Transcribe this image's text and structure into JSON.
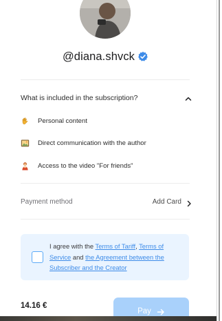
{
  "profile": {
    "username": "@diana.shvck",
    "verified_icon": "verified-badge-icon",
    "accent_color": "#3d8be8"
  },
  "subscription": {
    "title": "What is included in the subscription?",
    "toggle_icon": "chevron-up-icon",
    "features": [
      {
        "icon": "hand-wave-icon",
        "label": "Personal content"
      },
      {
        "icon": "picture-frame-icon",
        "label": "Direct communication with the author"
      },
      {
        "icon": "person-emoji-icon",
        "label": "Access to the video \"For friends\""
      }
    ]
  },
  "payment": {
    "label": "Payment method",
    "action": "Add Card"
  },
  "agreement": {
    "prefix": "I agree with the",
    "terms_of_tariff": "Terms of Tariff",
    "comma": ",",
    "terms_of_service": "Terms of Service",
    "and": "and",
    "agreement_link": "the Agreement between the Subscriber and the Creator",
    "checked": false
  },
  "checkout": {
    "price": "14.16 €",
    "pay_label": "Pay",
    "pay_button_color": "#a9d1fb"
  }
}
